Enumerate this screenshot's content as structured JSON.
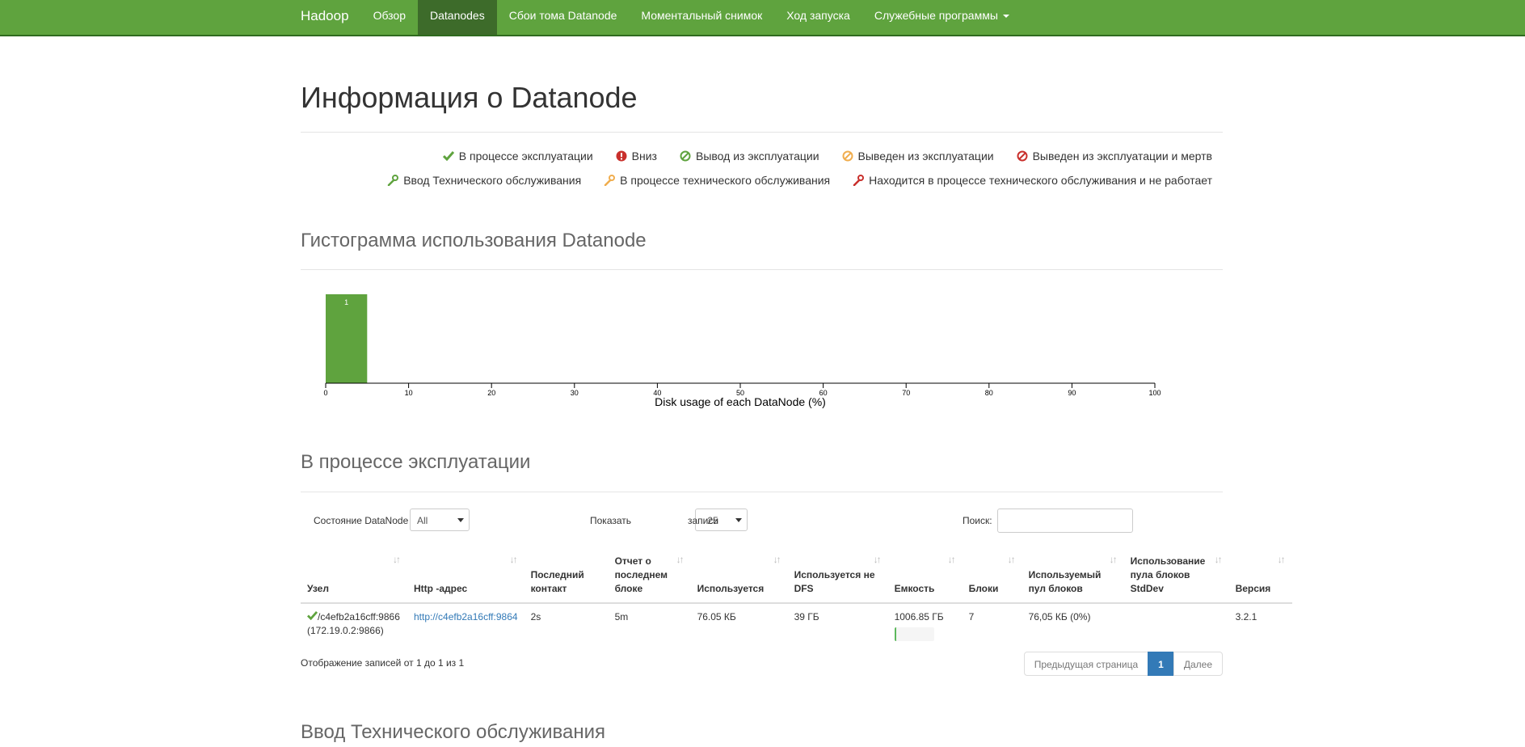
{
  "nav": {
    "brand": "Hadoop",
    "items": [
      {
        "label": "Обзор"
      },
      {
        "label": "Datanodes",
        "active": true
      },
      {
        "label": "Сбои тома Datanode"
      },
      {
        "label": "Моментальный снимок"
      },
      {
        "label": "Ход запуска"
      },
      {
        "label": "Служебные программы"
      }
    ]
  },
  "page_title": "Информация о Datanode",
  "legend": {
    "row1": [
      {
        "icon": "check-icon",
        "label": "В процессе эксплуатации",
        "color": "#5fa33e"
      },
      {
        "icon": "exclamation-icon",
        "label": "Вниз",
        "color": "#c9302c"
      },
      {
        "icon": "ban-icon",
        "label": "Вывод из эксплуатации",
        "color": "#5fa33e"
      },
      {
        "icon": "ban-icon",
        "label": "Выведен из эксплуатации",
        "color": "#f0ad4e"
      },
      {
        "icon": "ban-icon",
        "label": "Выведен из эксплуатации и мертв",
        "color": "#c9302c"
      }
    ],
    "row2": [
      {
        "icon": "wrench-icon",
        "label": "Ввод Технического обслуживания",
        "color": "#5fa33e"
      },
      {
        "icon": "wrench-icon",
        "label": "В процессе технического обслуживания",
        "color": "#f0ad4e"
      },
      {
        "icon": "wrench-icon",
        "label": "Находится в процессе технического обслуживания и не работает",
        "color": "#c9302c"
      }
    ]
  },
  "histogram_title": "Гистограмма использования Datanode",
  "chart_data": {
    "type": "bar",
    "xlabel": "Disk usage of each DataNode (%)",
    "x_ticks": [
      0,
      10,
      20,
      30,
      40,
      50,
      60,
      70,
      80,
      90,
      100
    ],
    "xlim": [
      0,
      100
    ],
    "bins": [
      {
        "x0": 0,
        "x1": 5,
        "count": 1,
        "label": "1"
      }
    ],
    "bar_color": "#5fa33e"
  },
  "in_service": {
    "title": "В процессе эксплуатации",
    "state_label": "Состояние DataNode",
    "state_value": "All",
    "show_label": "Показать",
    "show_value": "25",
    "records_label": "записи",
    "search_label": "Поиск:",
    "search_value": "",
    "columns": [
      "Узел",
      "Http -адрес",
      "Последний контакт",
      "Отчет о последнем блоке",
      "Используется",
      "Используется не DFS",
      "Емкость",
      "Блоки",
      "Используемый пул блоков",
      "Использование пула блоков StdDev",
      "Версия"
    ],
    "rows": [
      {
        "node": "/c4efb2a16cff:9866",
        "node_ip": "(172.19.0.2:9866)",
        "http": "http://c4efb2a16cff:9864",
        "last_contact": "2s",
        "last_block": "5m",
        "used": "76.05 КБ",
        "non_dfs": "39 ГБ",
        "capacity": "1006.85 ГБ",
        "capacity_used_fraction": 0.04,
        "blocks": "7",
        "pool_used": "76,05 КБ (0%)",
        "pool_stddev": "",
        "version": "3.2.1"
      }
    ],
    "summary": "Отображение записей от 1 до 1 из 1",
    "pager": {
      "prev": "Предыдущая страница",
      "page": "1",
      "next": "Далее"
    }
  },
  "maintenance_title": "Ввод Технического обслуживания"
}
